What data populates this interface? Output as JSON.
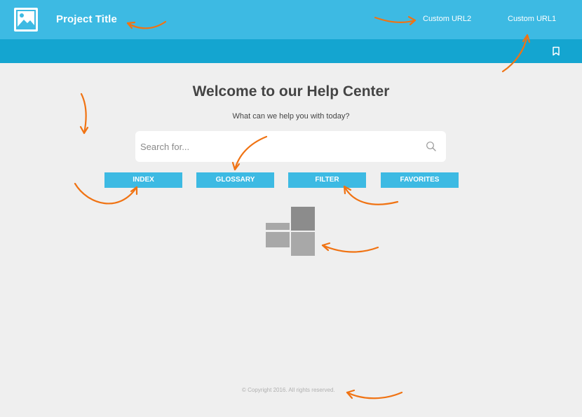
{
  "header": {
    "logo_icon": "image-icon",
    "project_title": "Project Title",
    "nav": [
      {
        "label": "Custom URL2"
      },
      {
        "label": "Custom URL1"
      }
    ],
    "bookmark_icon": "bookmark-icon",
    "colors": {
      "primary": "#3dbae3",
      "secondary": "#14a5d0"
    }
  },
  "main": {
    "title": "Welcome to our Help Center",
    "subtitle": "What can we help you with today?",
    "search": {
      "placeholder": "Search for...",
      "value": "",
      "icon": "search-icon"
    },
    "buttons": [
      {
        "label": "INDEX"
      },
      {
        "label": "GLOSSARY"
      },
      {
        "label": "FILTER"
      },
      {
        "label": "FAVORITES"
      }
    ],
    "tiles_icon": "tiles-icon"
  },
  "footer": {
    "copyright": "© Copyright 2016. All rights reserved."
  },
  "annotation_color": "#f07313"
}
